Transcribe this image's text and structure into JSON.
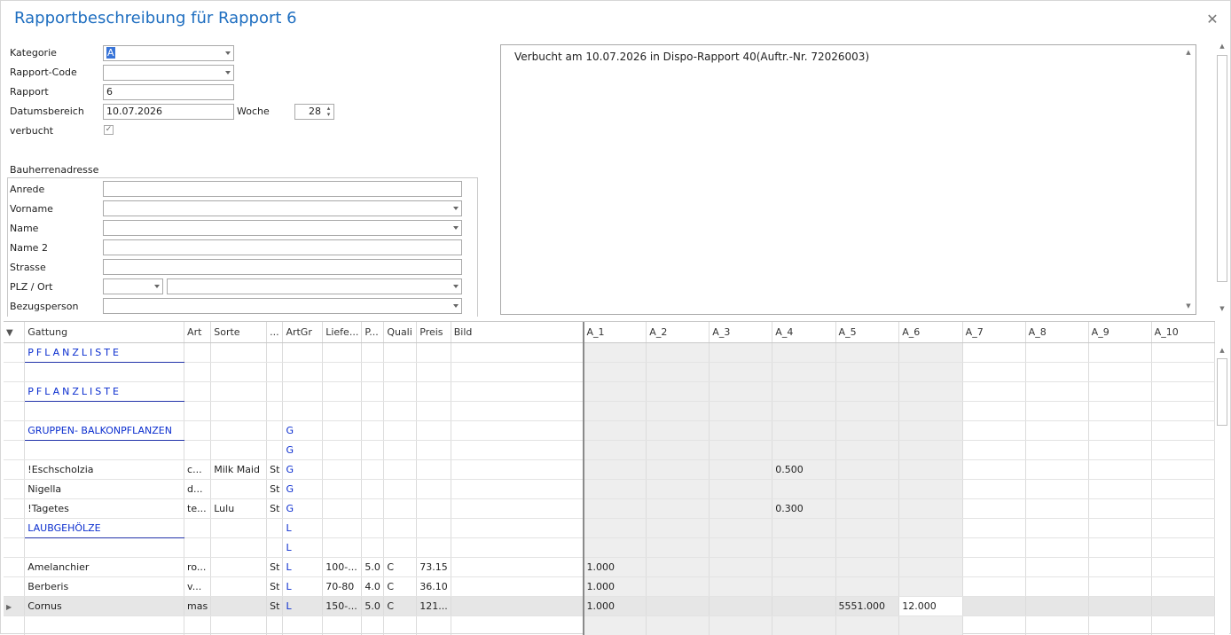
{
  "window": {
    "title": "Rapportbeschreibung für Rapport 6"
  },
  "form": {
    "kategorie": {
      "label": "Kategorie",
      "value": "A"
    },
    "rapport_code": {
      "label": "Rapport-Code",
      "value": ""
    },
    "rapport": {
      "label": "Rapport",
      "value": "6"
    },
    "datumsbereich": {
      "label": "Datumsbereich",
      "value": "10.07.2026"
    },
    "woche": {
      "label": "Woche",
      "value": "28"
    },
    "verbucht": {
      "label": "verbucht",
      "checked": true,
      "glyph": "✓"
    }
  },
  "bauherr": {
    "title": "Bauherrenadresse",
    "anrede": "Anrede",
    "vorname": "Vorname",
    "name": "Name",
    "name2": "Name 2",
    "strasse": "Strasse",
    "plz_ort": "PLZ / Ort",
    "bezugsperson": "Bezugsperson"
  },
  "memo": {
    "text": "Verbucht am 10.07.2026 in Dispo-Rapport 40(Auftr.-Nr. 72026003)"
  },
  "grid": {
    "columns": [
      "Gattung",
      "Art",
      "Sorte",
      "...",
      "ArtGr",
      "Liefe...",
      "P...",
      "Quali",
      "Preis",
      "Bild",
      "A_1",
      "A_2",
      "A_3",
      "A_4",
      "A_5",
      "A_6",
      "A_7",
      "A_8",
      "A_9",
      "A_10"
    ],
    "rows": [
      {
        "c": [
          "PFLANZLISTE",
          "",
          "",
          "",
          "",
          "",
          "",
          "",
          "",
          "",
          "",
          "",
          "",
          "",
          "",
          "",
          "",
          "",
          "",
          ""
        ]
      },
      {
        "c": [
          "",
          "",
          "",
          "",
          "",
          "",
          "",
          "",
          "",
          "",
          "",
          "",
          "",
          "",
          "",
          "",
          "",
          "",
          "",
          ""
        ]
      },
      {
        "c": [
          "PFLANZLISTE",
          "",
          "",
          "",
          "",
          "",
          "",
          "",
          "",
          "",
          "",
          "",
          "",
          "",
          "",
          "",
          "",
          "",
          "",
          ""
        ]
      },
      {
        "c": [
          "",
          "",
          "",
          "",
          "",
          "",
          "",
          "",
          "",
          "",
          "",
          "",
          "",
          "",
          "",
          "",
          "",
          "",
          "",
          ""
        ]
      },
      {
        "c": [
          "GRUPPEN- BALKONPFLANZEN",
          "",
          "",
          "",
          "G",
          "",
          "",
          "",
          "",
          "",
          "",
          "",
          "",
          "",
          "",
          "",
          "",
          "",
          "",
          ""
        ]
      },
      {
        "c": [
          "",
          "",
          "",
          "",
          "G",
          "",
          "",
          "",
          "",
          "",
          "",
          "",
          "",
          "",
          "",
          "",
          "",
          "",
          "",
          ""
        ]
      },
      {
        "c": [
          "!Eschscholzia",
          "c...",
          "Milk Maid",
          "St",
          "G",
          "",
          "",
          "",
          "",
          "",
          "",
          "",
          "",
          "0.500",
          "",
          "",
          "",
          "",
          "",
          ""
        ]
      },
      {
        "c": [
          "Nigella",
          "d...",
          "",
          "St",
          "G",
          "",
          "",
          "",
          "",
          "",
          "",
          "",
          "",
          "",
          "",
          "",
          "",
          "",
          "",
          ""
        ]
      },
      {
        "c": [
          "!Tagetes",
          "te...",
          "Lulu",
          "St",
          "G",
          "",
          "",
          "",
          "",
          "",
          "",
          "",
          "",
          "0.300",
          "",
          "",
          "",
          "",
          "",
          ""
        ]
      },
      {
        "c": [
          "LAUBGEHÖLZE",
          "",
          "",
          "",
          "L",
          "",
          "",
          "",
          "",
          "",
          "",
          "",
          "",
          "",
          "",
          "",
          "",
          "",
          "",
          ""
        ]
      },
      {
        "c": [
          "",
          "",
          "",
          "",
          "L",
          "",
          "",
          "",
          "",
          "",
          "",
          "",
          "",
          "",
          "",
          "",
          "",
          "",
          "",
          ""
        ]
      },
      {
        "c": [
          "Amelanchier",
          "ro...",
          "",
          "St",
          "L",
          "100-...",
          "5.0",
          "C",
          "73.15",
          "",
          "1.000",
          "",
          "",
          "",
          "",
          "",
          "",
          "",
          "",
          ""
        ]
      },
      {
        "c": [
          "Berberis",
          "v...",
          "",
          "St",
          "L",
          "70-80",
          "4.0",
          "C",
          "36.10",
          "",
          "1.000",
          "",
          "",
          "",
          "",
          "",
          "",
          "",
          "",
          ""
        ]
      },
      {
        "c": [
          "Cornus",
          "mas",
          "",
          "St",
          "L",
          "150-...",
          "5.0",
          "C",
          "121...",
          "",
          "1.000",
          "",
          "",
          "",
          "5551.000",
          "12.000",
          "",
          "",
          "",
          ""
        ]
      },
      {
        "c": [
          "",
          "",
          "",
          "",
          "",
          "",
          "",
          "",
          "",
          "",
          "",
          "",
          "",
          "",
          "",
          "",
          "",
          "",
          "",
          ""
        ]
      }
    ]
  },
  "icons": {
    "filter": "filter-icon",
    "row_pointer": "row-pointer-icon",
    "close": "close-icon",
    "dropdown": "chevron-down-icon"
  }
}
